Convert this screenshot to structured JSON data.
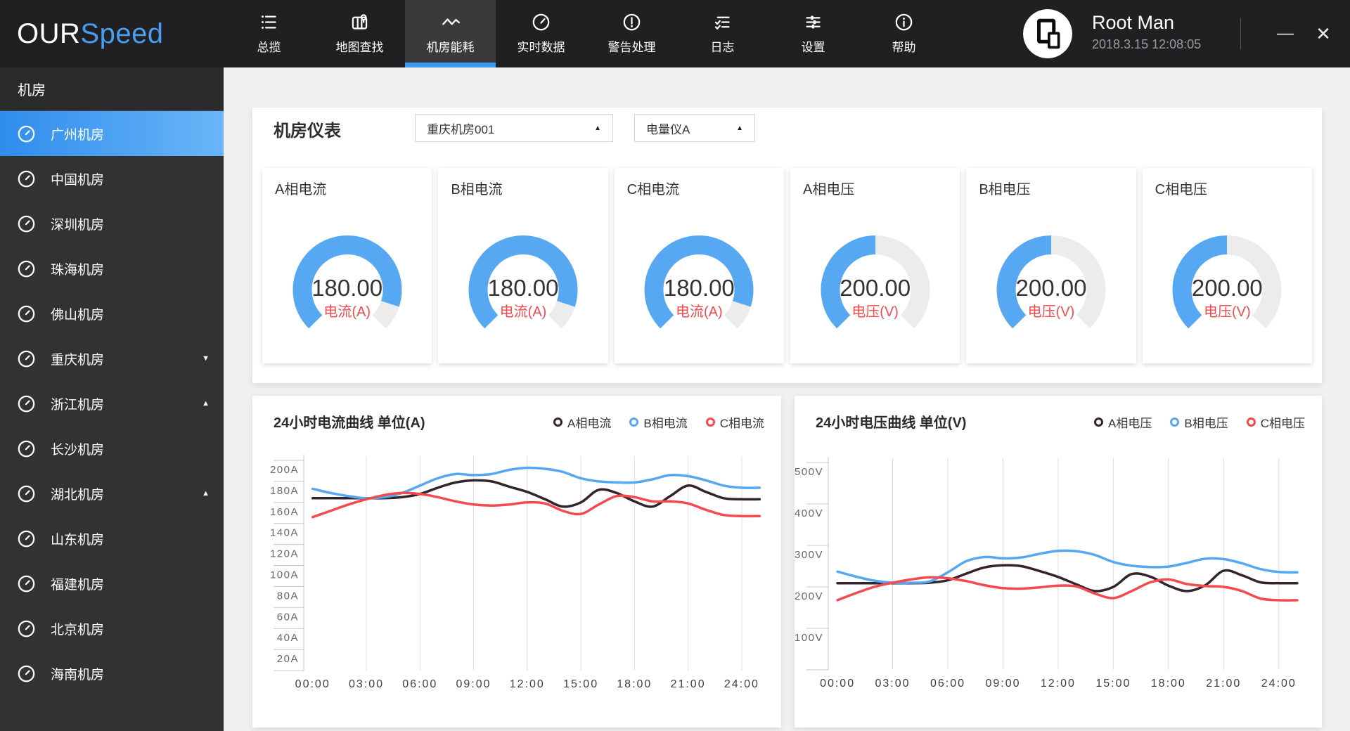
{
  "topbar": {
    "logo_primary": "OUR",
    "logo_accent": "Speed",
    "nav": [
      {
        "label": "总揽",
        "icon": "list-icon",
        "active": false
      },
      {
        "label": "地图查找",
        "icon": "map-search-icon",
        "active": false
      },
      {
        "label": "机房能耗",
        "icon": "pulse-icon",
        "active": true
      },
      {
        "label": "实时数据",
        "icon": "speedometer-icon",
        "active": false
      },
      {
        "label": "警告处理",
        "icon": "alert-icon",
        "active": false
      },
      {
        "label": "日志",
        "icon": "log-icon",
        "active": false
      },
      {
        "label": "设置",
        "icon": "settings-icon",
        "active": false
      },
      {
        "label": "帮助",
        "icon": "help-icon",
        "active": false
      }
    ],
    "user": {
      "name": "Root Man",
      "datetime": "2018.3.15 12:08:05"
    },
    "window": {
      "minimize": "—",
      "close": "✕"
    }
  },
  "sidebar": {
    "header": "机房",
    "items": [
      {
        "label": "广州机房",
        "active": true,
        "caret": null
      },
      {
        "label": "中国机房",
        "active": false,
        "caret": null
      },
      {
        "label": "深圳机房",
        "active": false,
        "caret": null
      },
      {
        "label": "珠海机房",
        "active": false,
        "caret": null
      },
      {
        "label": "佛山机房",
        "active": false,
        "caret": null
      },
      {
        "label": "重庆机房",
        "active": false,
        "caret": "down"
      },
      {
        "label": "浙江机房",
        "active": false,
        "caret": "up"
      },
      {
        "label": "长沙机房",
        "active": false,
        "caret": null
      },
      {
        "label": "湖北机房",
        "active": false,
        "caret": "up"
      },
      {
        "label": "山东机房",
        "active": false,
        "caret": null
      },
      {
        "label": "福建机房",
        "active": false,
        "caret": null
      },
      {
        "label": "北京机房",
        "active": false,
        "caret": null
      },
      {
        "label": "海南机房",
        "active": false,
        "caret": null
      }
    ]
  },
  "meters": {
    "title": "机房仪表",
    "room_select": "重庆机房001",
    "meter_select": "电量仪A",
    "caret": "▲",
    "gauge_color": "#57a8f2",
    "gauge_track_color": "#ececec",
    "cards": [
      {
        "title": "A相电流",
        "value": "180.00",
        "unit_label": "电流(A)",
        "fraction": 0.9
      },
      {
        "title": "B相电流",
        "value": "180.00",
        "unit_label": "电流(A)",
        "fraction": 0.9
      },
      {
        "title": "C相电流",
        "value": "180.00",
        "unit_label": "电流(A)",
        "fraction": 0.9
      },
      {
        "title": "A相电压",
        "value": "200.00",
        "unit_label": "电压(V)",
        "fraction": 0.5
      },
      {
        "title": "B相电压",
        "value": "200.00",
        "unit_label": "电压(V)",
        "fraction": 0.5
      },
      {
        "title": "C相电压",
        "value": "200.00",
        "unit_label": "电压(V)",
        "fraction": 0.5
      }
    ]
  },
  "chart_data": [
    {
      "type": "line",
      "title": "24小时电流曲线 单位(A)",
      "x_hours": [
        0,
        1,
        2,
        3,
        4,
        5,
        6,
        7,
        8,
        9,
        10,
        11,
        12,
        13,
        14,
        15,
        16,
        17,
        18,
        19,
        20,
        21,
        22,
        23,
        24,
        25
      ],
      "x_tick_labels": [
        "00:00",
        "03:00",
        "06:00",
        "09:00",
        "12:00",
        "15:00",
        "18:00",
        "21:00",
        "24:00"
      ],
      "x_tick_hours": [
        0,
        3,
        6,
        9,
        12,
        15,
        18,
        21,
        24
      ],
      "ylim": [
        0,
        200
      ],
      "ytick_values": [
        200,
        180,
        160,
        140,
        120,
        100,
        80,
        60,
        40,
        20
      ],
      "ytick_labels": [
        "200A",
        "180A",
        "160A",
        "140A",
        "120A",
        "100A",
        "80A",
        "60A",
        "40A",
        "20A"
      ],
      "grid": "vertical-only",
      "legend_position": "top-right",
      "series": [
        {
          "name": "A相电流",
          "color": "#33242c",
          "values": [
            164,
            164,
            164,
            164,
            164,
            165,
            168,
            174,
            179,
            181,
            180,
            175,
            170,
            163,
            156,
            160,
            172,
            169,
            161,
            156,
            166,
            176,
            170,
            164,
            163,
            163
          ]
        },
        {
          "name": "B相电流",
          "color": "#55a7f2",
          "values": [
            173,
            169,
            166,
            164,
            165,
            169,
            176,
            183,
            187,
            186,
            187,
            191,
            193,
            192,
            189,
            183,
            180,
            179,
            179,
            182,
            186,
            185,
            181,
            176,
            174,
            174
          ]
        },
        {
          "name": "C相电流",
          "color": "#f5494d",
          "values": [
            146,
            152,
            158,
            163,
            167,
            169,
            168,
            165,
            161,
            158,
            157,
            158,
            160,
            159,
            152,
            149,
            158,
            166,
            165,
            161,
            161,
            159,
            153,
            148,
            147,
            147
          ]
        }
      ]
    },
    {
      "type": "line",
      "title": "24小时电压曲线 单位(V)",
      "x_hours": [
        0,
        1,
        2,
        3,
        4,
        5,
        6,
        7,
        8,
        9,
        10,
        11,
        12,
        13,
        14,
        15,
        16,
        17,
        18,
        19,
        20,
        21,
        22,
        23,
        24,
        25
      ],
      "x_tick_labels": [
        "00:00",
        "03:00",
        "06:00",
        "09:00",
        "12:00",
        "15:00",
        "18:00",
        "21:00",
        "24:00"
      ],
      "x_tick_hours": [
        0,
        3,
        6,
        9,
        12,
        15,
        18,
        21,
        24
      ],
      "ylim": [
        0,
        500
      ],
      "ytick_values": [
        500,
        400,
        300,
        200,
        100
      ],
      "ytick_labels": [
        "500V",
        "400V",
        "300V",
        "200V",
        "100V"
      ],
      "grid": "vertical-only",
      "legend_position": "top-right",
      "series": [
        {
          "name": "A相电压",
          "color": "#33242c",
          "values": [
            209,
            209,
            209,
            209,
            209,
            210,
            216,
            232,
            247,
            252,
            250,
            238,
            224,
            206,
            190,
            200,
            231,
            225,
            203,
            190,
            204,
            239,
            228,
            211,
            209,
            209
          ]
        },
        {
          "name": "B相电压",
          "color": "#55a7f2",
          "values": [
            237,
            225,
            215,
            210,
            210,
            213,
            235,
            262,
            272,
            269,
            271,
            280,
            287,
            286,
            277,
            260,
            251,
            248,
            249,
            258,
            268,
            267,
            257,
            243,
            236,
            235
          ]
        },
        {
          "name": "C相电压",
          "color": "#f5494d",
          "values": [
            168,
            185,
            200,
            210,
            218,
            223,
            221,
            214,
            204,
            197,
            196,
            199,
            203,
            201,
            184,
            173,
            190,
            211,
            218,
            207,
            202,
            200,
            190,
            172,
            168,
            168
          ]
        }
      ]
    }
  ]
}
